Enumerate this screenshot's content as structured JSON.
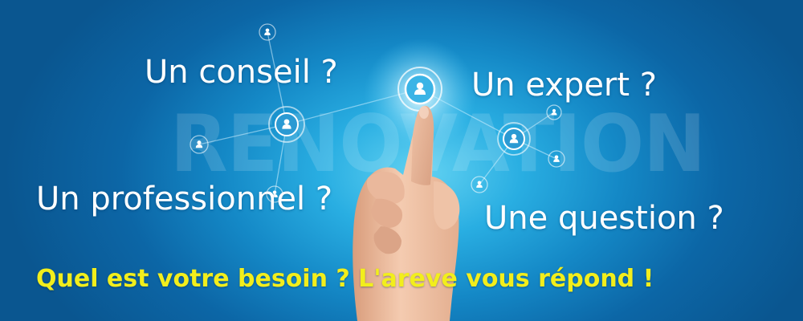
{
  "watermark": "RENOVATION",
  "questions": {
    "conseil": "Un conseil ?",
    "expert": "Un expert ?",
    "professionnel": "Un professionnel ?",
    "question": "Une question ?"
  },
  "tagline": "Quel est votre besoin ? L'areve vous répond !",
  "colors": {
    "background": "#1a8fcf",
    "text": "#ffffff",
    "tagline": "#f2ee1c"
  },
  "icons": [
    "user-node-icon",
    "pointing-hand"
  ]
}
